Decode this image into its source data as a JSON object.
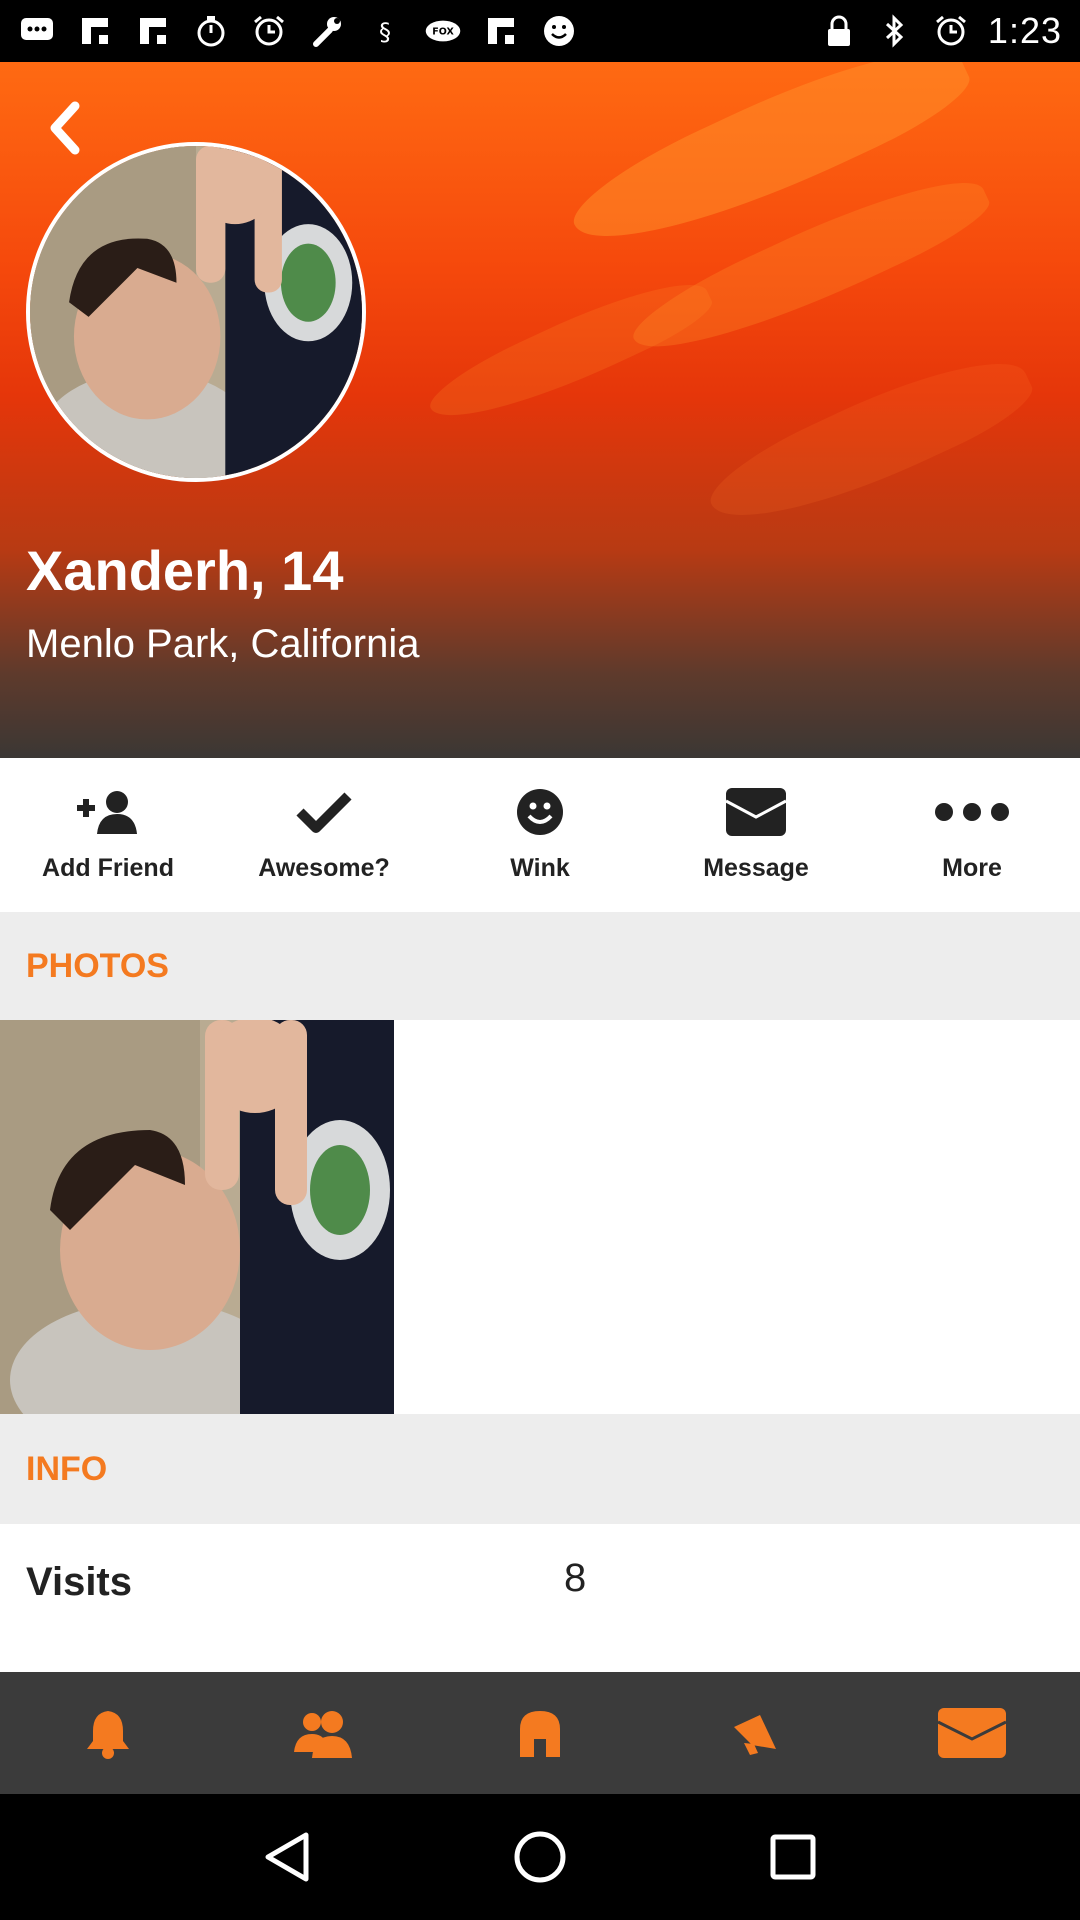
{
  "status_bar": {
    "time": "1:23",
    "icons": [
      "chat-icon",
      "flipboard-icon",
      "flipboard-icon",
      "stopwatch-icon",
      "alarm-icon",
      "wrench-icon",
      "app-icon",
      "fox-sports-icon",
      "flipboard-icon",
      "smiley-icon",
      "lock-icon",
      "bluetooth-icon",
      "alarm-icon"
    ]
  },
  "profile": {
    "name": "Xanderh, 14",
    "location": "Menlo Park, California"
  },
  "actions": [
    {
      "label": "Add Friend",
      "icon": "add-friend-icon"
    },
    {
      "label": "Awesome?",
      "icon": "checkmark-icon"
    },
    {
      "label": "Wink",
      "icon": "smiley-icon"
    },
    {
      "label": "Message",
      "icon": "envelope-icon"
    },
    {
      "label": "More",
      "icon": "more-dots-icon"
    }
  ],
  "sections": {
    "photos": "PHOTOS",
    "info": "INFO"
  },
  "info": {
    "visits_label": "Visits",
    "visits_value": "8"
  },
  "tabbar": [
    "bell-icon",
    "friends-icon",
    "home-icon",
    "megaphone-icon",
    "envelope-icon"
  ],
  "colors": {
    "accent": "#f47a20",
    "header_top": "#ff6a12",
    "header_mid": "#e5360a",
    "tabbar_bg": "#3b3b3b",
    "section_bg": "#ededed"
  }
}
